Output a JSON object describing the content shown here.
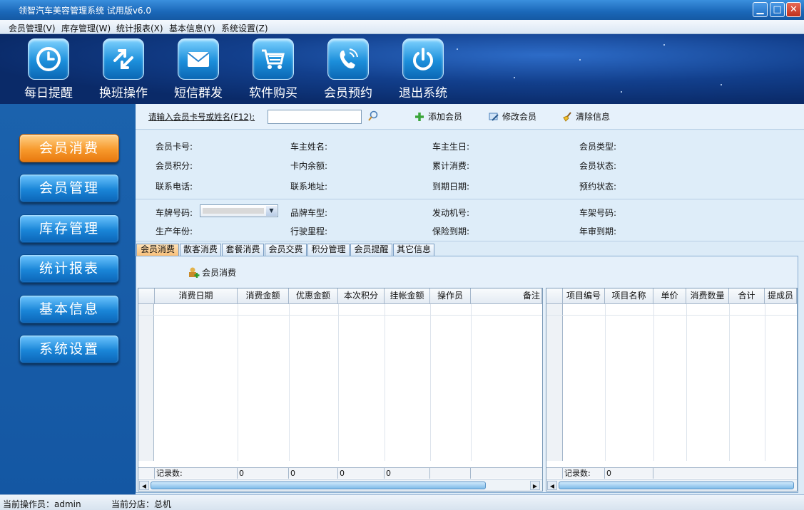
{
  "window": {
    "title": "领智汽车美容管理系统 试用版v6.0"
  },
  "menu": [
    "会员管理(V)",
    "库存管理(W)",
    "统计报表(X)",
    "基本信息(Y)",
    "系统设置(Z)"
  ],
  "toolbar": [
    {
      "label": "每日提醒",
      "icon": "clock-icon"
    },
    {
      "label": "换班操作",
      "icon": "swap-arrows-icon"
    },
    {
      "label": "短信群发",
      "icon": "envelope-icon"
    },
    {
      "label": "软件购买",
      "icon": "shopping-cart-icon"
    },
    {
      "label": "会员预约",
      "icon": "phone-icon"
    },
    {
      "label": "退出系统",
      "icon": "power-icon"
    }
  ],
  "sidebar": [
    {
      "label": "会员消费",
      "active": true
    },
    {
      "label": "会员管理"
    },
    {
      "label": "库存管理"
    },
    {
      "label": "统计报表"
    },
    {
      "label": "基本信息"
    },
    {
      "label": "系统设置"
    }
  ],
  "search": {
    "label": "请输入会员卡号或姓名(F12):",
    "value": "",
    "add": "添加会员",
    "edit": "修改会员",
    "clear": "清除信息"
  },
  "member_fields": [
    [
      "会员卡号:",
      "车主姓名:",
      "车主生日:",
      "会员类型:"
    ],
    [
      "会员积分:",
      "卡内余额:",
      "累计消费:",
      "会员状态:"
    ],
    [
      "联系电话:",
      "联系地址:",
      "到期日期:",
      "预约状态:"
    ]
  ],
  "vehicle_fields": [
    [
      "车牌号码:",
      "品牌车型:",
      "发动机号:",
      "车架号码:"
    ],
    [
      "生产年份:",
      "行驶里程:",
      "保险到期:",
      "年审到期:"
    ]
  ],
  "tabs": [
    "会员消费",
    "散客消费",
    "套餐消费",
    "会员交费",
    "积分管理",
    "会员提醒",
    "其它信息"
  ],
  "tab_action": "会员消费",
  "left_grid": {
    "headers": [
      "消费日期",
      "消费金额",
      "优惠金额",
      "本次积分",
      "挂帐金额",
      "操作员",
      "备注"
    ],
    "footer": [
      "记录数:",
      "0",
      "0",
      "0",
      "0"
    ]
  },
  "right_grid": {
    "headers": [
      "项目编号",
      "项目名称",
      "单价",
      "消费数量",
      "合计",
      "提成员"
    ],
    "footer": [
      "记录数:",
      "0"
    ]
  },
  "statusbar": {
    "operator": "当前操作员：admin",
    "branch": "当前分店：总机"
  }
}
